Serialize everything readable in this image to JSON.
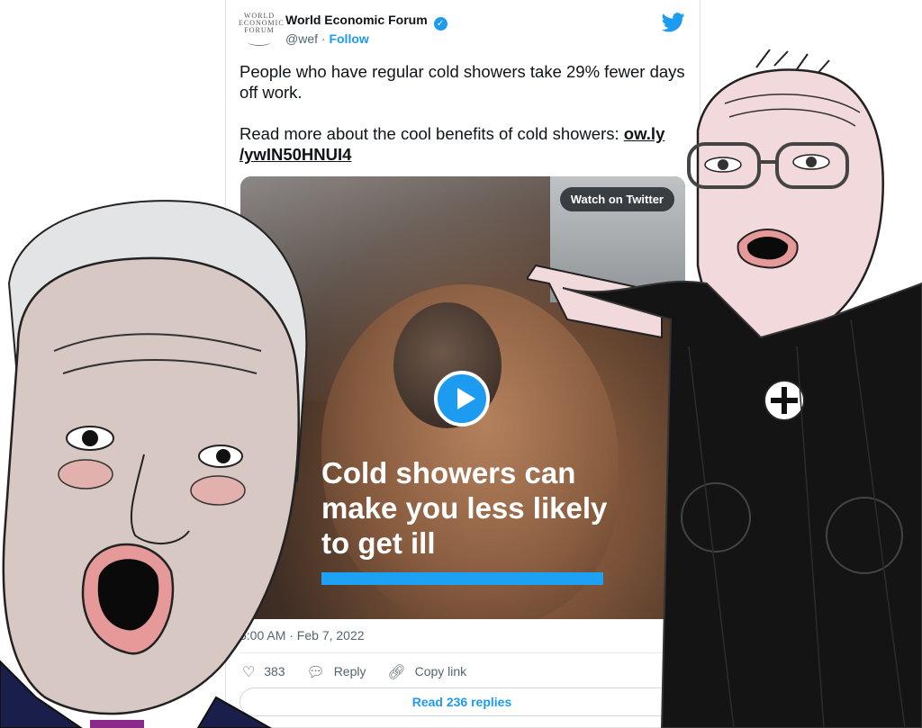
{
  "tweet": {
    "author_name": "World Economic Forum",
    "handle": "@wef",
    "separator": "·",
    "follow_label": "Follow",
    "logo_lines": [
      "WORLD",
      "ECONOMIC",
      "FORUM"
    ],
    "text_line1": "People who have regular cold showers take 29% fewer days off work.",
    "text_line2_prefix": "Read more about the cool benefits of cold showers:",
    "link_text": "ow.ly /ywIN50HNUI4",
    "watch_label": "Watch on Twitter",
    "video_caption": "Cold showers can make you less likely to get ill",
    "timestamp": "5:00 AM · Feb 7, 2022",
    "likes": "383",
    "reply_label": "Reply",
    "copy_link_label": "Copy link",
    "read_replies_label": "Read 236 replies"
  },
  "icons": [
    "verified-badge-icon",
    "twitter-bird-icon",
    "play-icon",
    "info-icon",
    "heart-icon",
    "reply-icon",
    "link-icon"
  ],
  "colors": {
    "accent": "#1d9bf0",
    "text": "#0f1419",
    "muted": "#536471",
    "caption_bar": "#1da1f2"
  }
}
